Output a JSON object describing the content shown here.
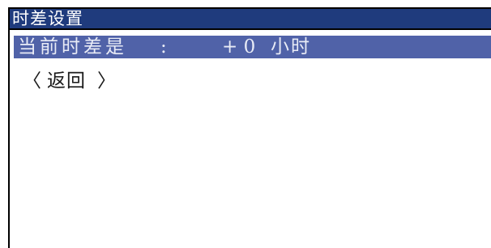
{
  "window": {
    "title": "时差设置"
  },
  "menu": {
    "time_offset": {
      "label": "当前时差是",
      "separator": ":",
      "value": "+ 0",
      "unit": "小时",
      "selected": true
    },
    "back": {
      "open": "〈",
      "label": "返回",
      "close": "〉",
      "selected": false
    }
  },
  "colors": {
    "title_bar": "#1F3B7D",
    "selected_row": "#5062A8",
    "selected_text": "#E8EBF6",
    "text": "#1A1A1A",
    "border": "#000000",
    "background": "#FFFFFF"
  }
}
